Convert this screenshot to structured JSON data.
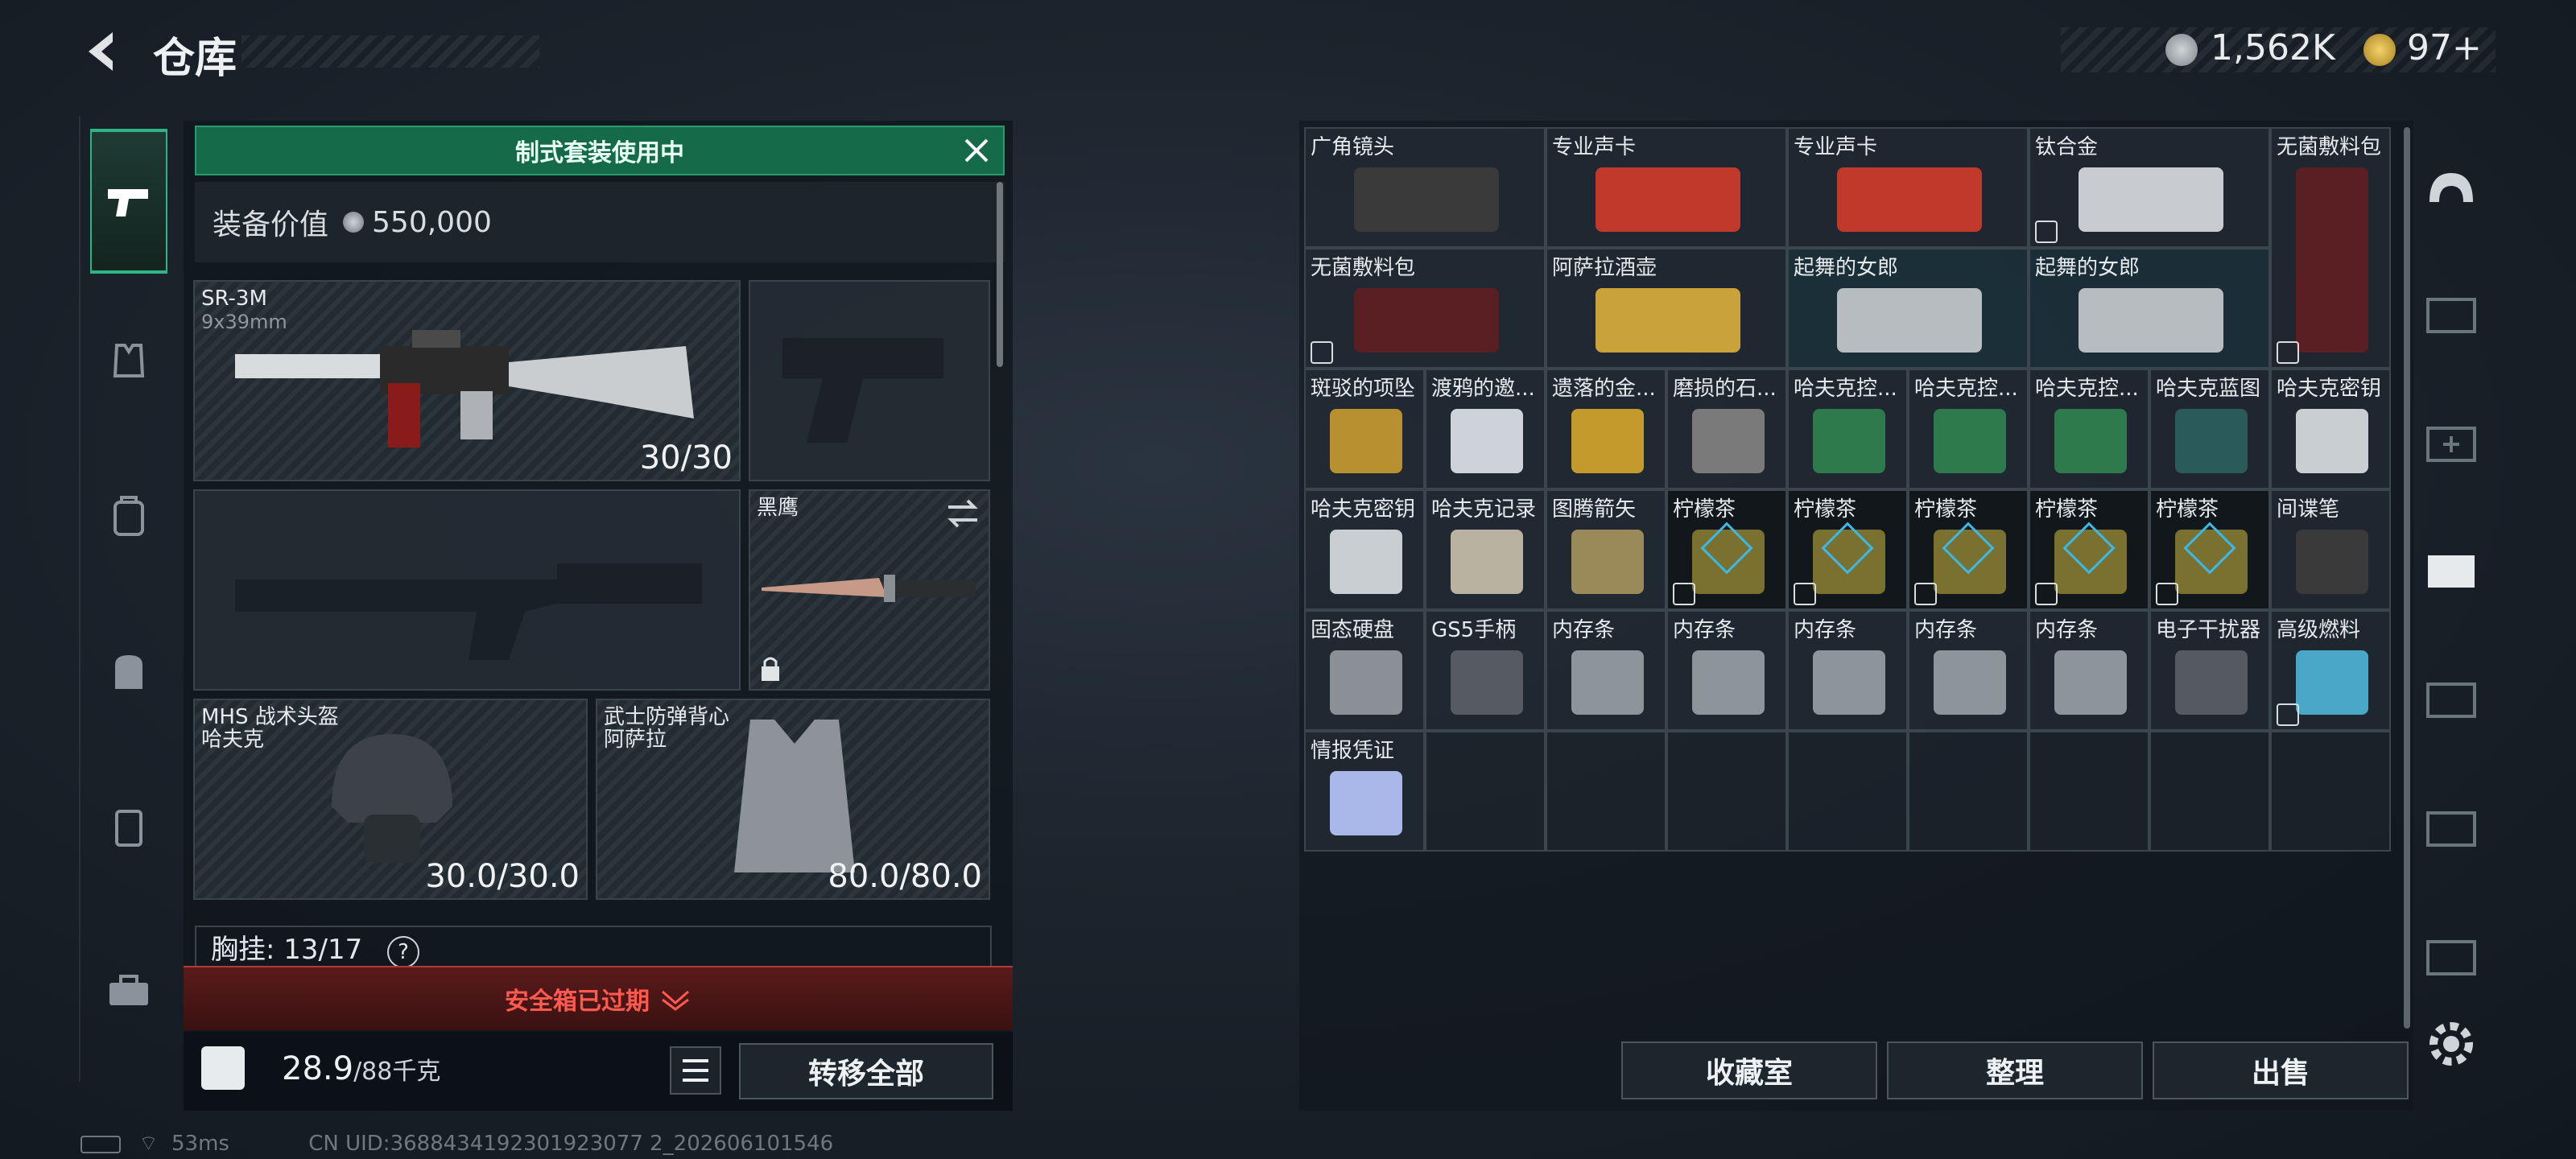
{
  "header": {
    "title": "仓库",
    "currency1": "1,562K",
    "currency2": "97+"
  },
  "loadout": {
    "banner": "制式套装使用中",
    "value_label": "装备价值",
    "value": "550,000",
    "primary": {
      "name": "SR-3M",
      "sub": "9x39mm",
      "ammo": "30/30"
    },
    "melee": {
      "name": "黑鹰"
    },
    "helmet": {
      "name": "MHS 战术头盔",
      "sub": "哈夫克",
      "durability": "30.0/30.0"
    },
    "armor": {
      "name": "武士防弹背心",
      "sub": "阿萨拉",
      "durability": "80.0/80.0"
    },
    "chest_rig": "胸挂: 13/17",
    "help": "?",
    "warning": "安全箱已过期",
    "weight": "28.9",
    "weight_max": "/88千克",
    "transfer_all": "转移全部"
  },
  "items": [
    {
      "name": "广角镜头",
      "color": "#3a3a3a"
    },
    {
      "name": "专业声卡",
      "color": "#c0392b"
    },
    {
      "name": "专业声卡",
      "color": "#c0392b"
    },
    {
      "name": "钛合金",
      "color": "#c8ccd0"
    },
    {
      "name": "无菌敷料包",
      "color": "#5a1f22"
    },
    {
      "name": "无菌敷料包",
      "color": "#5a1f22"
    },
    {
      "name": "阿萨拉酒壶",
      "color": "#c9a23a"
    },
    {
      "name": "起舞的女郎",
      "color": "#b7bcc0"
    },
    {
      "name": "起舞的女郎",
      "color": "#b7bcc0"
    },
    {
      "name": "斑驳的项坠",
      "color": "#b8902f"
    },
    {
      "name": "渡鸦的邀...",
      "color": "#cdd3d8"
    },
    {
      "name": "遗落的金...",
      "color": "#c49a2c"
    },
    {
      "name": "磨损的石...",
      "color": "#7a7a7a"
    },
    {
      "name": "哈夫克控...",
      "color": "#2e7a4c"
    },
    {
      "name": "哈夫克控...",
      "color": "#2e7a4c"
    },
    {
      "name": "哈夫克控...",
      "color": "#2e7a4c"
    },
    {
      "name": "哈夫克蓝图",
      "color": "#2a5a5a"
    },
    {
      "name": "哈夫克密钥",
      "color": "#c9ced2"
    },
    {
      "name": "哈夫克密钥",
      "color": "#c9ced2"
    },
    {
      "name": "哈夫克记录",
      "color": "#b9b2a0"
    },
    {
      "name": "图腾箭矢",
      "color": "#9a8a5a"
    },
    {
      "name": "柠檬茶",
      "color": "#7a7030"
    },
    {
      "name": "柠檬茶",
      "color": "#7a7030"
    },
    {
      "name": "柠檬茶",
      "color": "#7a7030"
    },
    {
      "name": "柠檬茶",
      "color": "#7a7030"
    },
    {
      "name": "柠檬茶",
      "color": "#7a7030"
    },
    {
      "name": "间谍笔",
      "color": "#3a3a3a"
    },
    {
      "name": "固态硬盘",
      "color": "#8a9096"
    },
    {
      "name": "GS5手柄",
      "color": "#555b60"
    },
    {
      "name": "内存条",
      "color": "#8d949a"
    },
    {
      "name": "内存条",
      "color": "#8d949a"
    },
    {
      "name": "内存条",
      "color": "#8d949a"
    },
    {
      "name": "内存条",
      "color": "#8d949a"
    },
    {
      "name": "内存条",
      "color": "#8d949a"
    },
    {
      "name": "电子干扰器",
      "color": "#555a60"
    },
    {
      "name": "高级燃料",
      "color": "#4aa7c8"
    },
    {
      "name": "情报凭证",
      "color": "#a9b8e8"
    }
  ],
  "actions": {
    "collection": "收藏室",
    "sort": "整理",
    "sell": "出售"
  },
  "status": {
    "ping": "53ms",
    "uid": "CN UID:3688434192301923077 2_202606101546"
  }
}
